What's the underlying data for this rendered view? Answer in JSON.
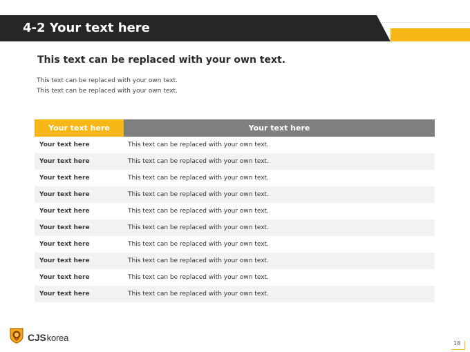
{
  "header": {
    "title": "4-2 Your text here",
    "colors": {
      "dark": "#262626",
      "accent": "#f7b717"
    }
  },
  "subtitle": "This text can be replaced with your own text.",
  "description": [
    "This text can be replaced with your own text.",
    "This text can be replaced with your own text."
  ],
  "table": {
    "headers": [
      "Your text here",
      "Your text here"
    ],
    "rows": [
      {
        "label": "Your text here",
        "text": "This text can be replaced with your own text."
      },
      {
        "label": "Your text here",
        "text": "This text can be replaced with your own text."
      },
      {
        "label": "Your text here",
        "text": "This text can be replaced with your own text."
      },
      {
        "label": "Your text here",
        "text": "This text can be replaced with your own text."
      },
      {
        "label": "Your text here",
        "text": "This text can be replaced with your own text."
      },
      {
        "label": "Your text here",
        "text": "This text can be replaced with your own text."
      },
      {
        "label": "Your text here",
        "text": "This text can be replaced with your own text."
      },
      {
        "label": "Your text here",
        "text": "This text can be replaced with your own text."
      },
      {
        "label": "Your text here",
        "text": "This text can be replaced with your own text."
      },
      {
        "label": "Your text here",
        "text": "This text can be replaced with your own text."
      }
    ]
  },
  "footer": {
    "logo_main": "CJS",
    "logo_sub": "korea",
    "logo_icon": "lion-shield-icon",
    "page_number": "18"
  }
}
